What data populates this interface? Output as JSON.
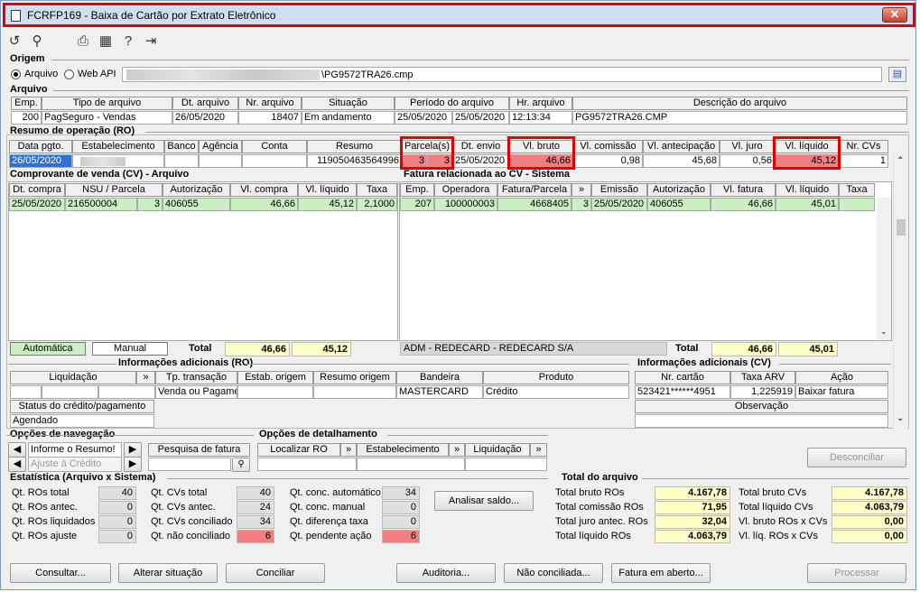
{
  "window": {
    "title": "FCRFP169 - Baixa de Cartão por Extrato Eletrônico",
    "close": "✕"
  },
  "toolbar": {
    "icons": [
      "undo-icon",
      "search-icon",
      "print-icon",
      "calendar-icon",
      "help-icon",
      "exit-icon"
    ]
  },
  "origem": {
    "title": "Origem",
    "arquivo": "Arquivo",
    "webapi": "Web API",
    "path": "\\PG9572TRA26.cmp"
  },
  "arquivo": {
    "title": "Arquivo",
    "headers": [
      "Emp.",
      "Tipo de arquivo",
      "Dt. arquivo",
      "Nr. arquivo",
      "Situação",
      "Período do arquivo",
      "Hr. arquivo",
      "Descrição do arquivo"
    ],
    "row": [
      "200",
      "PagSeguro - Vendas",
      "26/05/2020",
      "18407",
      "Em andamento",
      "25/05/2020",
      "25/05/2020",
      "12:13:34",
      "PG9572TRA26.CMP"
    ]
  },
  "ro": {
    "title": "Resumo de operação (RO)",
    "headers": [
      "Data pgto.",
      "Estabelecimento",
      "Banco",
      "Agência",
      "Conta",
      "Resumo",
      "Parcela(s)",
      "Dt. envio",
      "Vl. bruto",
      "Vl. comissão",
      "Vl. antecipação",
      "Vl. juro",
      "Vl. líquido",
      "Nr. CVs"
    ],
    "row": [
      "26/05/2020",
      "",
      "",
      "",
      "",
      "119050463564996",
      "3",
      "3",
      "25/05/2020",
      "46,66",
      "0,98",
      "45,68",
      "0,56",
      "45,12",
      "1"
    ]
  },
  "cv": {
    "title": "Comprovante de venda (CV) - Arquivo",
    "headers": [
      "Dt. compra",
      "NSU / Parcela",
      "Autorização",
      "Vl. compra",
      "Vl. líquido",
      "Taxa"
    ],
    "row": [
      "25/05/2020",
      "216500004",
      "3",
      "406055",
      "46,66",
      "45,12",
      "2,1000"
    ],
    "automatica": "Automática",
    "manual": "Manual",
    "total_label": "Total",
    "total1": "46,66",
    "total2": "45,12"
  },
  "fatura": {
    "title": "Fatura relacionada ao CV - Sistema",
    "headers": [
      "Emp.",
      "Operadora",
      "Fatura/Parcela",
      "»",
      "Emissão",
      "Autorização",
      "Vl. fatura",
      "Vl. líquido",
      "Taxa"
    ],
    "row": [
      "207",
      "100000003",
      "4668405",
      "3",
      "25/05/2020",
      "406055",
      "46,66",
      "45,01",
      ""
    ],
    "footer": "ADM - REDECARD - REDECARD S/A",
    "total_label": "Total",
    "total1": "46,66",
    "total2": "45,01"
  },
  "info_ro": {
    "title": "Informações adicionais (RO)",
    "headers": [
      "Liquidação",
      "»",
      "Tp. transação",
      "Estab. origem",
      "Resumo origem",
      "Bandeira",
      "Produto"
    ],
    "row": [
      "",
      "",
      "",
      "Venda ou Pagame",
      "",
      "",
      "MASTERCARD",
      "Crédito"
    ],
    "status_label": "Status do crédito/pagamento",
    "status": "Agendado"
  },
  "info_cv": {
    "title": "Informações adicionais (CV)",
    "headers": [
      "Nr. cartão",
      "Taxa ARV",
      "Ação"
    ],
    "row": [
      "523421******4951",
      "1,225919",
      "Baixar fatura"
    ],
    "obs_label": "Observação"
  },
  "nav": {
    "title": "Opções de navegação",
    "input": "Informe o Resumo!",
    "select": "Ajuste à Crédito",
    "pesquisa": "Pesquisa de fatura"
  },
  "detalhe": {
    "title": "Opções de detalhamento",
    "items": [
      "Localizar RO",
      "»",
      "Estabelecimento",
      "»",
      "Liquidação",
      "»"
    ]
  },
  "desconciliar": "Desconciliar",
  "estat": {
    "title": "Estatística (Arquivo x Sistema)",
    "col1": [
      [
        "Qt. ROs total",
        "40"
      ],
      [
        "Qt. ROs antec.",
        "0"
      ],
      [
        "Qt. ROs liquidados",
        "0"
      ],
      [
        "Qt. ROs ajuste",
        "0"
      ]
    ],
    "col2": [
      [
        "Qt. CVs total",
        "40"
      ],
      [
        "Qt. CVs antec.",
        "24"
      ],
      [
        "Qt. CVs conciliado",
        "34"
      ],
      [
        "Qt. não conciliado",
        "6"
      ]
    ],
    "col3": [
      [
        "Qt. conc. automático",
        "34"
      ],
      [
        "Qt. conc. manual",
        "0"
      ],
      [
        "Qt. diferença taxa",
        "0"
      ],
      [
        "Qt. pendente ação",
        "6"
      ]
    ],
    "analisar": "Analisar saldo..."
  },
  "total_arquivo": {
    "title": "Total do arquivo",
    "left": [
      [
        "Total bruto ROs",
        "4.167,78"
      ],
      [
        "Total comissão ROs",
        "71,95"
      ],
      [
        "Total juro antec. ROs",
        "32,04"
      ],
      [
        "Total líquido ROs",
        "4.063,79"
      ]
    ],
    "right": [
      [
        "Total bruto CVs",
        "4.167,78"
      ],
      [
        "Total líquido CVs",
        "4.063,79"
      ],
      [
        "Vl. bruto ROs x CVs",
        "0,00"
      ],
      [
        "Vl. líq. ROs x CVs",
        "0,00"
      ]
    ]
  },
  "buttons": [
    "Consultar...",
    "Alterar situação",
    "Conciliar",
    "Auditoria...",
    "Não conciliada...",
    "Fatura em aberto...",
    "Processar"
  ]
}
